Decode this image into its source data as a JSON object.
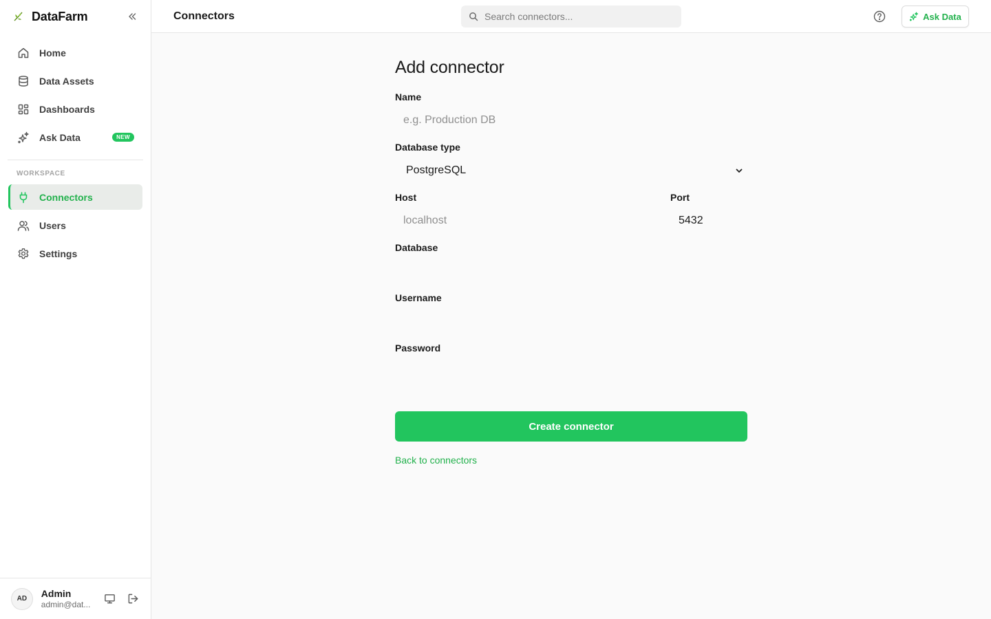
{
  "app": {
    "name": "DataFarm"
  },
  "sidebar": {
    "items": [
      {
        "label": "Home",
        "icon": "home-icon"
      },
      {
        "label": "Data Assets",
        "icon": "database-icon"
      },
      {
        "label": "Dashboards",
        "icon": "dashboard-icon"
      },
      {
        "label": "Ask Data",
        "icon": "sparkles-icon",
        "badge": "NEW"
      }
    ],
    "section_label": "WORKSPACE",
    "workspace_items": [
      {
        "label": "Connectors",
        "icon": "plug-icon",
        "active": true
      },
      {
        "label": "Users",
        "icon": "users-icon"
      },
      {
        "label": "Settings",
        "icon": "gear-icon"
      }
    ]
  },
  "user": {
    "initials": "AD",
    "name": "Admin",
    "email": "admin@dat..."
  },
  "header": {
    "title": "Connectors",
    "search_placeholder": "Search connectors...",
    "ask_button": "Ask Data"
  },
  "form": {
    "title": "Add connector",
    "name": {
      "label": "Name",
      "placeholder": "e.g. Production DB",
      "value": ""
    },
    "db_type": {
      "label": "Database type",
      "value": "PostgreSQL"
    },
    "host": {
      "label": "Host",
      "placeholder": "localhost",
      "value": ""
    },
    "port": {
      "label": "Port",
      "value": "5432"
    },
    "database": {
      "label": "Database",
      "value": ""
    },
    "username": {
      "label": "Username",
      "value": ""
    },
    "password": {
      "label": "Password",
      "value": ""
    },
    "submit": "Create connector",
    "back": "Back to connectors"
  },
  "colors": {
    "accent": "#22c55e",
    "accent_text": "#22b14c",
    "active_bg": "#e9ece9"
  }
}
